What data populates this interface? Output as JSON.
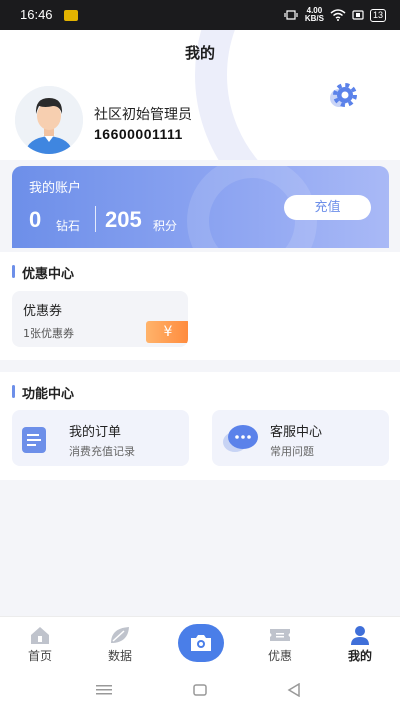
{
  "status_bar": {
    "time": "16:46",
    "net_speed_value": "4.00",
    "net_speed_unit": "KB/S",
    "battery": "13"
  },
  "header": {
    "title": "我的",
    "user_name": "社区初始管理员",
    "user_phone": "16600001111"
  },
  "account": {
    "title": "我的账户",
    "diamonds_value": "0",
    "diamonds_label": "钻石",
    "points_value": "205",
    "points_label": "积分",
    "recharge_label": "充值"
  },
  "coupons": {
    "section_title": "优惠中心",
    "card_title": "优惠券",
    "card_sub": "1张优惠券",
    "ticket_symbol": "¥"
  },
  "functions": {
    "section_title": "功能中心",
    "items": [
      {
        "title": "我的订单",
        "sub": "消费充值记录",
        "icon": "document-list-icon"
      },
      {
        "title": "客服中心",
        "sub": "常用问题",
        "icon": "chat-bubble-icon"
      }
    ]
  },
  "tabbar": {
    "items": [
      {
        "label": "首页",
        "icon": "home-icon"
      },
      {
        "label": "数据",
        "icon": "leaf-icon"
      },
      {
        "label": "",
        "icon": "camera-icon"
      },
      {
        "label": "优惠",
        "icon": "ticket-icon"
      },
      {
        "label": "我的",
        "icon": "user-icon",
        "active": true
      }
    ]
  },
  "colors": {
    "accent": "#6d8fe9",
    "camera_button": "#4a7ee8",
    "coupon_orange": "#ff8a3c"
  }
}
